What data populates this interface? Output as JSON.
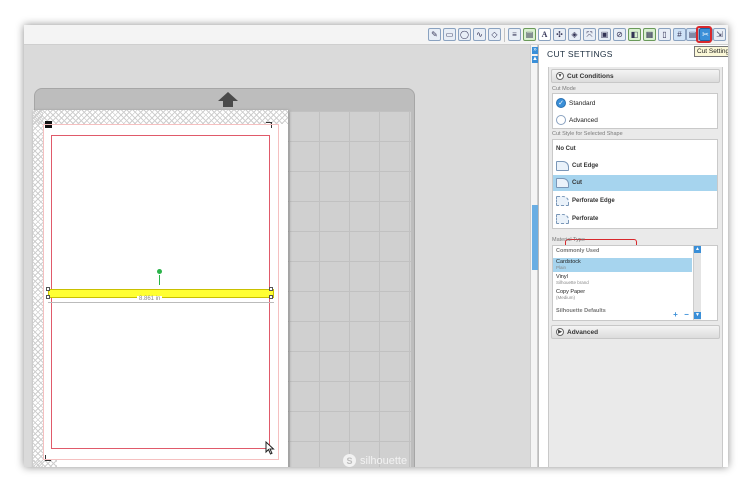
{
  "toolbar": {
    "tooltip": "Cut Settings",
    "text_tool_glyph": "A",
    "icons": [
      "draw-icon",
      "rectangle-icon",
      "ellipse-icon",
      "freehand-icon",
      "polygon-icon",
      "line-style-icon",
      "fill-icon",
      "text-icon",
      "align-icon",
      "replicate-icon",
      "transform-icon",
      "offset-icon",
      "trace-icon",
      "layers-icon",
      "page-setup-icon",
      "registration-icon",
      "grid-icon",
      "library-icon",
      "store-icon",
      "cut-settings-icon",
      "send-to-cutter-icon"
    ]
  },
  "canvas": {
    "brand": "silhouette",
    "dimension_label": "8.861 in"
  },
  "panel": {
    "title": "CUT SETTINGS",
    "cut_conditions": {
      "label": "Cut Conditions",
      "cut_mode_label": "Cut Mode",
      "modes": [
        {
          "label": "Standard",
          "selected": true
        },
        {
          "label": "Advanced",
          "selected": false
        }
      ],
      "cut_style_label": "Cut Style for Selected Shape",
      "styles": [
        {
          "label": "No Cut",
          "selected": false
        },
        {
          "label": "Cut Edge",
          "selected": false
        },
        {
          "label": "Cut",
          "selected": true
        },
        {
          "label": "Perforate Edge",
          "selected": false
        },
        {
          "label": "Perforate",
          "selected": false
        }
      ]
    },
    "material": {
      "label": "Material Type",
      "list_header": "Commonly Used",
      "items": [
        {
          "name": "Cardstock",
          "sub": "Plain",
          "selected": true
        },
        {
          "name": "Vinyl",
          "sub": "Silhouette brand",
          "selected": false
        },
        {
          "name": "Copy Paper",
          "sub": "(Medium)",
          "selected": false
        }
      ],
      "group2": "Silhouette Defaults",
      "add": "+",
      "remove": "−"
    },
    "advanced": {
      "label": "Advanced"
    }
  },
  "colors": {
    "accent": "#3a8fd8",
    "selection": "#a6d4ee",
    "highlight": "#d8282c",
    "strip": "#ffff33"
  }
}
